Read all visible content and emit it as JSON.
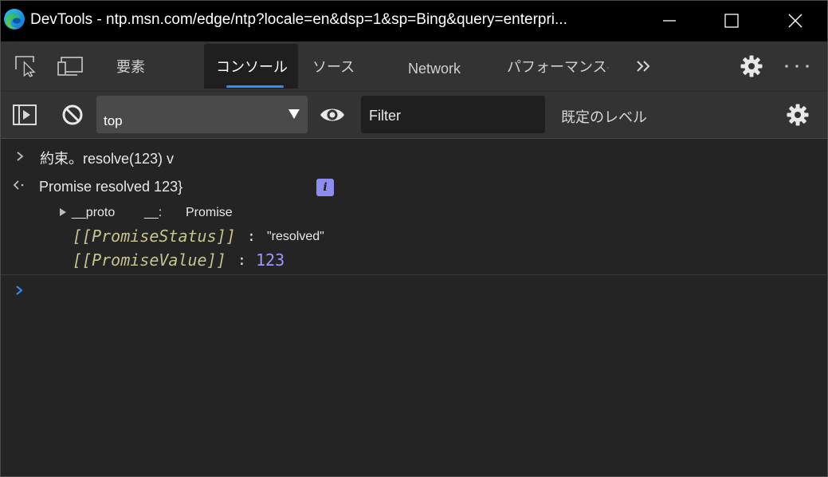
{
  "window": {
    "title": "DevTools - ntp.msn.com/edge/ntp?locale=en&dsp=1&sp=Bing&query=enterpri..."
  },
  "tabs": [
    {
      "label": "要素"
    },
    {
      "label": "コンソール"
    },
    {
      "label": "ソース"
    },
    {
      "label": "Network"
    },
    {
      "label": "パフォーマンス"
    }
  ],
  "toolbar": {
    "context_value": "top",
    "filter_placeholder": "Filter",
    "levels_label": "既定のレベル"
  },
  "console": {
    "input_line": "約束。resolve(123) v",
    "result_line": "Promise resolved 123}",
    "info_badge": "i",
    "proto_key": "__proto",
    "proto_sep": "__:",
    "proto_value": "Promise",
    "status_key": "[[PromiseStatus]]",
    "status_colon": ":",
    "status_value": "\"resolved\"",
    "value_key": "[[PromiseValue]]",
    "value_colon": ":",
    "value_value": "123"
  },
  "colors": {
    "accent": "#2f8ffc",
    "titlebar": "#000000",
    "panel": "#333333",
    "console_bg": "#242424",
    "property_key": "#c7c28e",
    "number": "#9d97ff"
  }
}
